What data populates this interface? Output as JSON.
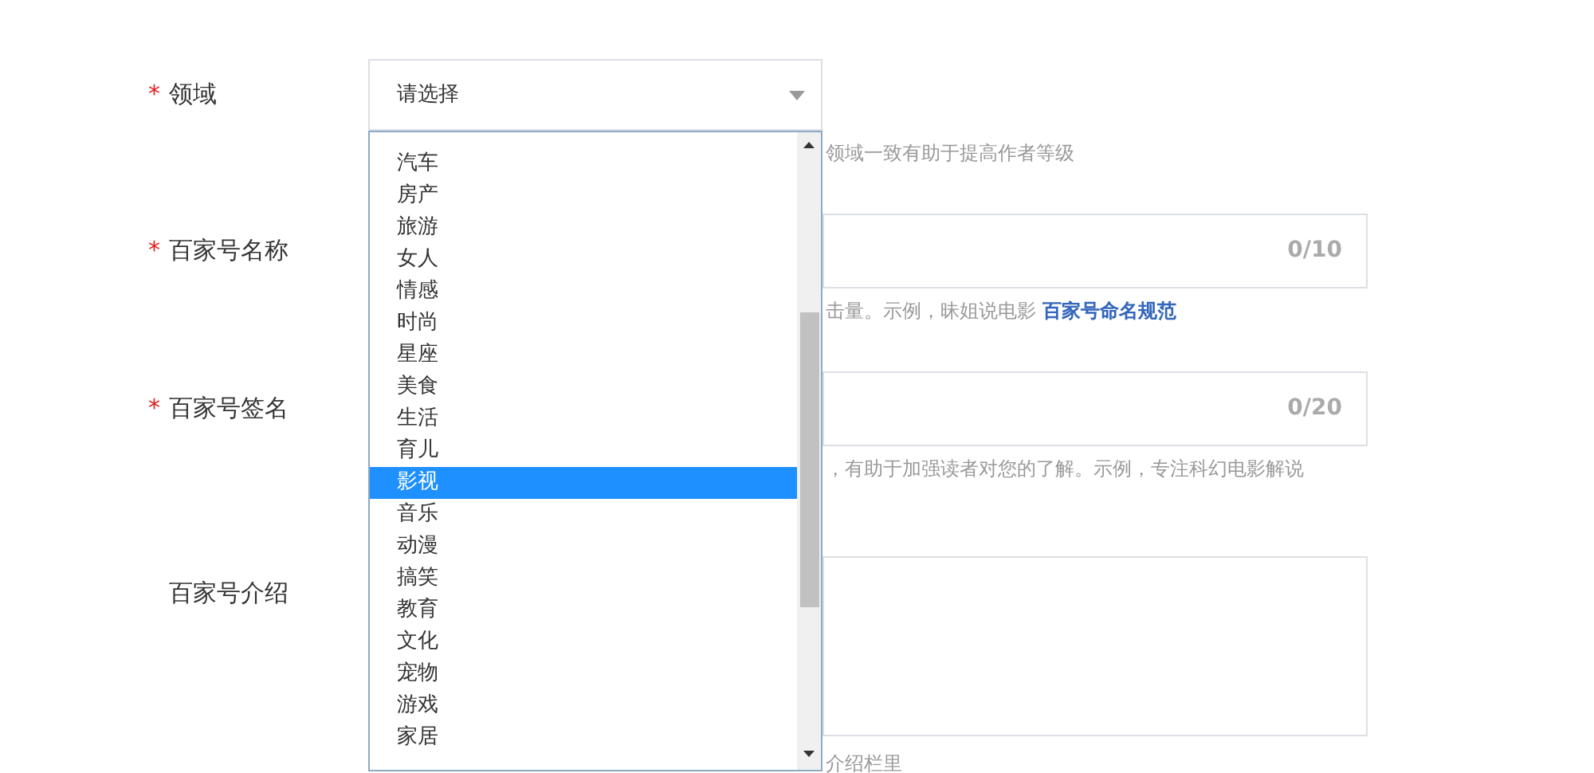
{
  "fields": [
    {
      "kind": "select",
      "mark": "*",
      "label": "领域",
      "value": "请选择",
      "hint": "领域一致有助于提高作者等级"
    },
    {
      "kind": "input",
      "mark": "*",
      "label": "百家号名称",
      "counter": "0/10",
      "hint": "击量。示例，昧姐说电影",
      "link": "百家号命名规范"
    },
    {
      "kind": "input",
      "mark": "*",
      "label": "百家号签名",
      "counter": "0/20",
      "hint": "，有助于加强读者对您的了解。示例，专注科幻电影解说"
    },
    {
      "kind": "textarea",
      "label": "百家号介绍",
      "hint": "介绍栏里"
    }
  ],
  "dropdown": {
    "options": [
      {
        "label": "汽车",
        "selected": false
      },
      {
        "label": "房产",
        "selected": false
      },
      {
        "label": "旅游",
        "selected": false
      },
      {
        "label": "女人",
        "selected": false
      },
      {
        "label": "情感",
        "selected": false
      },
      {
        "label": "时尚",
        "selected": false
      },
      {
        "label": "星座",
        "selected": false
      },
      {
        "label": "美食",
        "selected": false
      },
      {
        "label": "生活",
        "selected": false
      },
      {
        "label": "育儿",
        "selected": false
      },
      {
        "label": "影视",
        "selected": true
      },
      {
        "label": "音乐",
        "selected": false
      },
      {
        "label": "动漫",
        "selected": false
      },
      {
        "label": "搞笑",
        "selected": false
      },
      {
        "label": "教育",
        "selected": false
      },
      {
        "label": "文化",
        "selected": false
      },
      {
        "label": "宠物",
        "selected": false
      },
      {
        "label": "游戏",
        "selected": false
      },
      {
        "label": "家居",
        "selected": false
      }
    ]
  }
}
